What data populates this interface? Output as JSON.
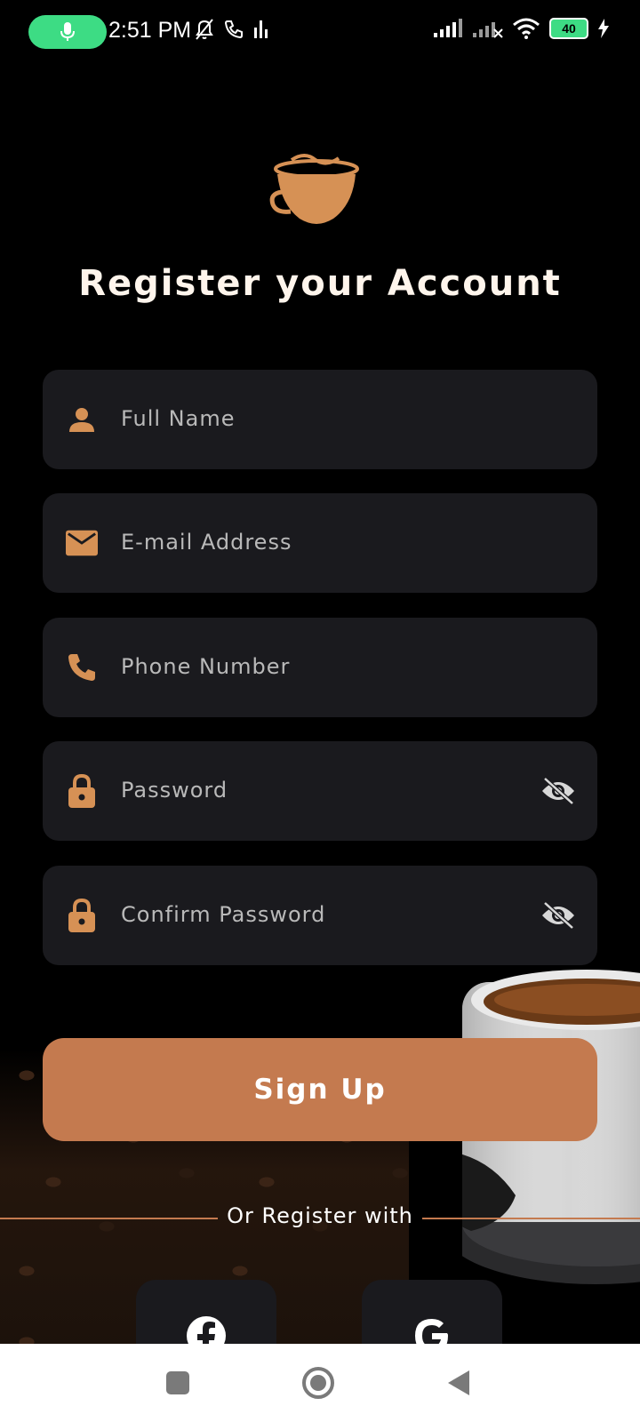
{
  "status_bar": {
    "time": "2:51 PM",
    "battery_level": "40",
    "mic_icon": "mic-icon",
    "accent_color": "#3ddc84"
  },
  "header": {
    "logo_icon": "coffee-cup-icon",
    "title": "Register your Account"
  },
  "form": {
    "full_name": {
      "placeholder": "Full Name",
      "icon": "person-icon",
      "value": ""
    },
    "email": {
      "placeholder": "E-mail Address",
      "icon": "mail-icon",
      "value": ""
    },
    "phone": {
      "placeholder": "Phone Number",
      "icon": "phone-icon",
      "value": ""
    },
    "password": {
      "placeholder": "Password",
      "icon": "lock-icon",
      "toggle_icon": "eye-off-icon",
      "value": ""
    },
    "confirm_password": {
      "placeholder": "Confirm Password",
      "icon": "lock-icon",
      "toggle_icon": "eye-off-icon",
      "value": ""
    }
  },
  "actions": {
    "signup_label": "Sign Up",
    "divider_text": "Or Register with",
    "social": [
      {
        "name": "facebook",
        "icon": "facebook-icon"
      },
      {
        "name": "google",
        "icon": "google-icon"
      }
    ]
  },
  "nav_bar": {
    "recent_icon": "square-icon",
    "home_icon": "circle-home-icon",
    "back_icon": "back-triangle-icon"
  },
  "colors": {
    "accent": "#c47a4f",
    "field_bg": "#1a1a1e",
    "background": "#000000"
  }
}
